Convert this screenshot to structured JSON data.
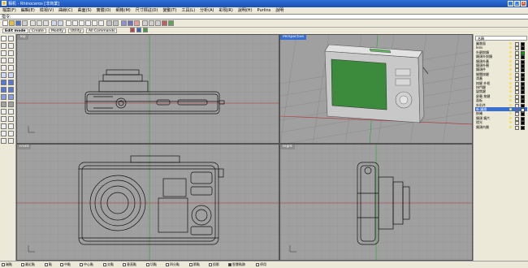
{
  "window": {
    "title": "相机 - Rhinoceros [非商業]",
    "min": "_",
    "max": "□",
    "close": "x"
  },
  "menu": [
    "檔案(F)",
    "編輯(E)",
    "檢視(V)",
    "曲線(C)",
    "曲面(S)",
    "實體(O)",
    "網格(M)",
    "尺寸標註(D)",
    "變動(T)",
    "工具(L)",
    "分析(A)",
    "彩現(R)",
    "說明(H)",
    "Purlins",
    "說明"
  ],
  "command": {
    "prompt": "指令:"
  },
  "tabs": [
    "Edit mode",
    "Create",
    "Modify",
    "Utility",
    "All Commands"
  ],
  "viewports": {
    "top": {
      "label": "Top"
    },
    "perspective": {
      "label": "Perspective"
    },
    "front": {
      "label": "Front"
    },
    "right": {
      "label": "Right"
    }
  },
  "layers": {
    "header": "名稱",
    "items": [
      {
        "name": "圖層面",
        "color": "#000000"
      },
      {
        "name": "lens",
        "color": "#000000"
      },
      {
        "name": "外觀銳鏡",
        "color": "#00a000"
      },
      {
        "name": "鏡頭外銳鏡",
        "color": "#000000"
      },
      {
        "name": "鏡頭外蓋",
        "color": "#000000"
      },
      {
        "name": "鏡頭外圈",
        "color": "#000000"
      },
      {
        "name": "鏡頭件",
        "color": "#000000"
      },
      {
        "name": "開關按鍵",
        "color": "#000000"
      },
      {
        "name": "滑蓋",
        "color": "#000000"
      },
      {
        "name": "按鍵 外框",
        "color": "#000000"
      },
      {
        "name": "快門鍵",
        "color": "#000000"
      },
      {
        "name": "變焦鍵",
        "color": "#000000"
      },
      {
        "name": "屏幕 按鍵",
        "color": "#000000"
      },
      {
        "name": "面板",
        "color": "#000000"
      },
      {
        "name": "外形件",
        "color": "#000000"
      },
      {
        "name": "新 圖層",
        "color": "#ffffff",
        "selected": true
      },
      {
        "name": "掛繩",
        "color": "#000000"
      },
      {
        "name": "鏡頭 鏡片",
        "color": "#000000"
      },
      {
        "name": "燈光",
        "color": "#000000"
      },
      {
        "name": "鏡頭內圈",
        "color": "#000000"
      }
    ]
  },
  "status": {
    "snaps": [
      {
        "label": "端點",
        "on": false
      },
      {
        "label": "最近點",
        "on": false
      },
      {
        "label": "點",
        "on": false
      },
      {
        "label": "中點",
        "on": false
      },
      {
        "label": "中心點",
        "on": false
      },
      {
        "label": "交點",
        "on": false
      },
      {
        "label": "垂直點",
        "on": false
      },
      {
        "label": "切點",
        "on": false
      },
      {
        "label": "四分點",
        "on": false
      },
      {
        "label": "節點",
        "on": false
      },
      {
        "label": "投影",
        "on": false
      },
      {
        "label": "智慧軌跡",
        "on": true
      },
      {
        "label": "停用",
        "on": false
      }
    ]
  },
  "colors": {
    "accent": "#3a6fd0",
    "viewport_bg": "#a0a0a0",
    "grid": "#8e8e8e",
    "axis_red": "#b03030",
    "axis_green": "#30a030",
    "screen_green": "#3c8a3c"
  }
}
